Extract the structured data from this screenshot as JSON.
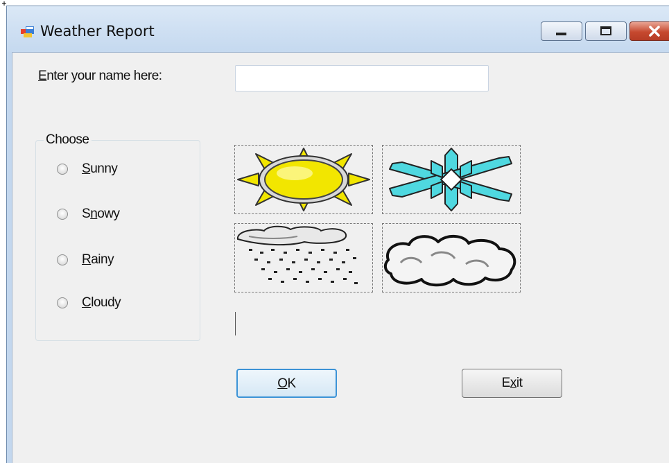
{
  "window": {
    "title": "Weather Report"
  },
  "form": {
    "name_label": "Enter your name here:",
    "name_label_access_key": "E",
    "name_label_rest": "nter your name here:",
    "name_value": "",
    "group_title": "Choose",
    "options": [
      {
        "label": "Sunny",
        "pre": "",
        "key": "S",
        "post": "unny",
        "checked": false
      },
      {
        "label": "Snowy",
        "pre": "S",
        "key": "n",
        "post": "owy",
        "checked": false
      },
      {
        "label": "Rainy",
        "pre": "",
        "key": "R",
        "post": "ainy",
        "checked": false
      },
      {
        "label": "Cloudy",
        "pre": "",
        "key": "C",
        "post": "loudy",
        "checked": false
      }
    ],
    "pictures": [
      {
        "icon": "sun-icon"
      },
      {
        "icon": "snowflake-icon"
      },
      {
        "icon": "rain-cloud-icon"
      },
      {
        "icon": "cloud-icon"
      }
    ],
    "result_label": "",
    "ok_button": {
      "pre": "",
      "key": "O",
      "post": "K"
    },
    "exit_button": {
      "pre": "E",
      "key": "x",
      "post": "it"
    }
  },
  "colors": {
    "sun": "#f2e600",
    "snow": "#4fd8e0",
    "focus_border": "#3c93d6",
    "close_button": "#c6492f"
  }
}
